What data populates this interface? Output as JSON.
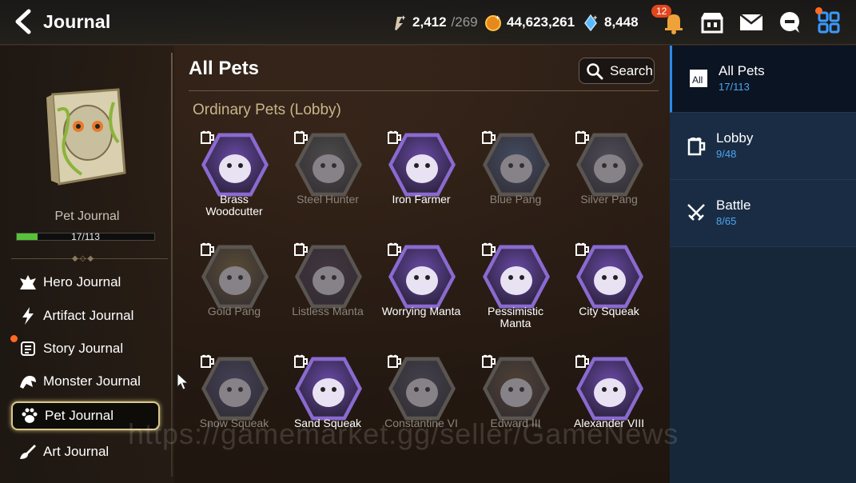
{
  "header": {
    "title": "Journal",
    "resources": [
      {
        "icon": "stamina-icon",
        "value": "2,412",
        "max": "/269"
      },
      {
        "icon": "gold-icon",
        "value": "44,623,261"
      },
      {
        "icon": "skystone-icon",
        "value": "8,448"
      }
    ],
    "notification_count": "12"
  },
  "left": {
    "journal_label": "Pet Journal",
    "progress_text": "17/113",
    "progress_fraction": 0.15,
    "nav": [
      {
        "label": "Hero Journal",
        "icon": "hero-icon"
      },
      {
        "label": "Artifact Journal",
        "icon": "lightning-icon"
      },
      {
        "label": "Story Journal",
        "icon": "scroll-icon"
      },
      {
        "label": "Monster Journal",
        "icon": "monster-icon"
      },
      {
        "label": "Pet Journal",
        "icon": "paw-icon"
      },
      {
        "label": "Art Journal",
        "icon": "brush-icon"
      }
    ]
  },
  "main": {
    "title": "All Pets",
    "search_label": "Search",
    "section_title": "Ordinary Pets (Lobby)",
    "pets": [
      {
        "name": "Brass Woodcutter",
        "owned": true,
        "color": "#6a4aa8"
      },
      {
        "name": "Steel Hunter",
        "owned": false,
        "color": "#4a4a4a"
      },
      {
        "name": "Iron Farmer",
        "owned": true,
        "color": "#6a4aa8"
      },
      {
        "name": "Blue Pang",
        "owned": false,
        "color": "#3a4a6a"
      },
      {
        "name": "Silver Pang",
        "owned": false,
        "color": "#4a4a5a"
      },
      {
        "name": "Gold Pang",
        "owned": false,
        "color": "#5a4a2a"
      },
      {
        "name": "Listless Manta",
        "owned": false,
        "color": "#3a2a3a"
      },
      {
        "name": "Worrying Manta",
        "owned": true,
        "color": "#6a4aa8"
      },
      {
        "name": "Pessimistic Manta",
        "owned": true,
        "color": "#6a4aa8"
      },
      {
        "name": "City Squeak",
        "owned": true,
        "color": "#6a4aa8"
      },
      {
        "name": "Snow Squeak",
        "owned": false,
        "color": "#3a3a5a"
      },
      {
        "name": "Sand Squeak",
        "owned": true,
        "color": "#6a4aa8"
      },
      {
        "name": "Constantine VI",
        "owned": false,
        "color": "#3a3a4a"
      },
      {
        "name": "Edward III",
        "owned": false,
        "color": "#4a3a2a"
      },
      {
        "name": "Alexander VIII",
        "owned": true,
        "color": "#6a4aa8"
      }
    ]
  },
  "right": {
    "tabs": [
      {
        "label": "All Pets",
        "count": "17/113",
        "icon": "all-icon"
      },
      {
        "label": "Lobby",
        "count": "9/48",
        "icon": "beer-mug-icon"
      },
      {
        "label": "Battle",
        "count": "8/65",
        "icon": "crossed-swords-icon"
      }
    ]
  },
  "watermark": "https://gamemarket.gg/seller/GameNews"
}
